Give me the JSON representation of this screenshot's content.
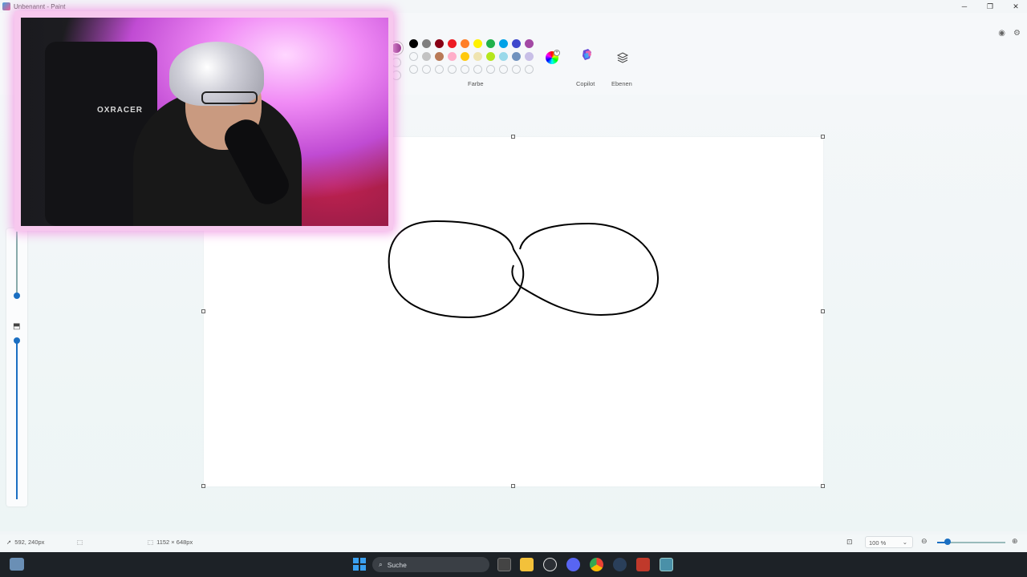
{
  "window": {
    "title": "Unbenannt - Paint"
  },
  "window_controls": {
    "minimize": "─",
    "maximize": "❐",
    "close": "✕"
  },
  "ribbon": {
    "color_group_label": "Farbe",
    "copilot_label": "Copilot",
    "layers_label": "Ebenen",
    "current_color": "#8a2b83",
    "palette_row1": [
      "#000000",
      "#7f7f7f",
      "#880015",
      "#ed1c24",
      "#ff7f27",
      "#fff200",
      "#22b14c",
      "#00a2e8",
      "#3f48cc",
      "#a349a4"
    ],
    "palette_row2": [
      "",
      "#c3c3c3",
      "#b97a57",
      "#ffaec9",
      "#ffc90e",
      "#efe4b0",
      "#b5e61d",
      "#99d9ea",
      "#7092be",
      "#c8bfe7"
    ],
    "palette_row3": [
      "",
      "",
      "",
      "",
      "",
      "",
      "",
      "",
      "",
      ""
    ]
  },
  "webcam": {
    "chair_brand": "OXRACER"
  },
  "statusbar": {
    "cursor_position": "592, 240px",
    "canvas_size": "1152 × 648px",
    "zoom_level": "100 %"
  },
  "taskbar": {
    "search_placeholder": "Suche"
  },
  "colors": {
    "accent": "#1b6fc2",
    "taskbar_bg": "#1d2227",
    "webcam_glow": "#f2a3e6"
  }
}
